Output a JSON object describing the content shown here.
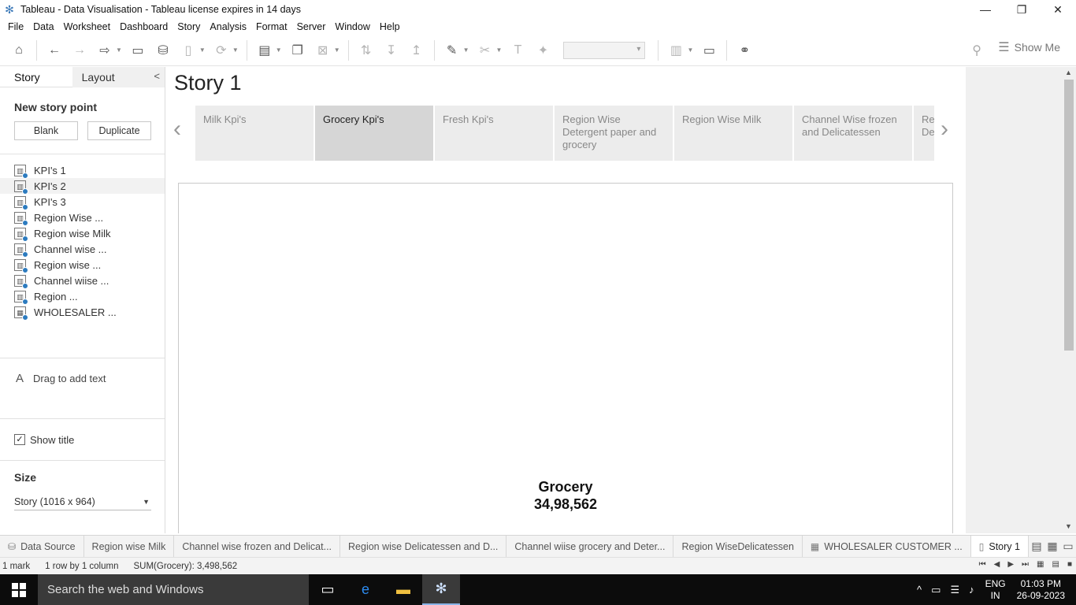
{
  "window": {
    "title": "Tableau - Data Visualisation - Tableau license expires in 14 days",
    "buttons": [
      "minimize",
      "restore",
      "close"
    ]
  },
  "menu": [
    "File",
    "Data",
    "Worksheet",
    "Dashboard",
    "Story",
    "Analysis",
    "Format",
    "Server",
    "Window",
    "Help"
  ],
  "toolbar": {
    "show_me_label": "Show Me"
  },
  "left_panel": {
    "tabs": {
      "story": "Story",
      "layout": "Layout"
    },
    "new_story_point_heading": "New story point",
    "blank_button": "Blank",
    "duplicate_button": "Duplicate",
    "sheets": [
      {
        "label": "KPI's 1",
        "icon": "worksheet-icon"
      },
      {
        "label": "KPI's 2",
        "icon": "worksheet-icon"
      },
      {
        "label": "KPI's 3",
        "icon": "worksheet-icon"
      },
      {
        "label": "Region Wise ...",
        "icon": "worksheet-icon"
      },
      {
        "label": "Region wise Milk",
        "icon": "worksheet-icon"
      },
      {
        "label": "Channel wise ...",
        "icon": "worksheet-icon"
      },
      {
        "label": "Region wise ...",
        "icon": "worksheet-icon"
      },
      {
        "label": "Channel wiise ...",
        "icon": "worksheet-icon"
      },
      {
        "label": "Region ...",
        "icon": "worksheet-icon"
      },
      {
        "label": "WHOLESALER ...",
        "icon": "dashboard-icon"
      }
    ],
    "drag_text": "Drag to add text",
    "show_title_label": "Show title",
    "show_title_checked": true,
    "size_heading": "Size",
    "size_value": "Story (1016 x 964)"
  },
  "story": {
    "title": "Story 1",
    "points": [
      {
        "label": "Milk Kpi's",
        "active": false
      },
      {
        "label": "Grocery Kpi's",
        "active": true
      },
      {
        "label": "Fresh Kpi's",
        "active": false
      },
      {
        "label": "Region Wise Detergent paper and grocery",
        "active": false
      },
      {
        "label": "Region Wise Milk",
        "active": false
      },
      {
        "label": "Channel Wise frozen and Delicatessen",
        "active": false
      },
      {
        "label": "Region Wise Detergent and Del...",
        "active": false
      }
    ],
    "kpi": {
      "label": "Grocery",
      "value": "34,98,562"
    }
  },
  "sheet_tabs": [
    {
      "label": "Data Source",
      "icon": "database-icon"
    },
    {
      "label": "Region wise Milk"
    },
    {
      "label": "Channel wise frozen and Delicat..."
    },
    {
      "label": "Region wise Delicatessen and D..."
    },
    {
      "label": "Channel wiise grocery and Deter..."
    },
    {
      "label": "Region WiseDelicatessen"
    },
    {
      "label": "WHOLESALER CUSTOMER ...",
      "icon": "dashboard-icon"
    },
    {
      "label": "Story 1",
      "icon": "story-icon",
      "active": true
    }
  ],
  "status": {
    "marks": "1 mark",
    "rows": "1 row by 1 column",
    "sum": "SUM(Grocery): 3,498,562"
  },
  "taskbar": {
    "search_placeholder": "Search the web and Windows",
    "lang_top": "ENG",
    "lang_bottom": "IN",
    "time": "01:03 PM",
    "date": "26-09-2023"
  },
  "colors": {
    "accent": "#2c7bbf",
    "active_story_point": "#d6d6d6",
    "inactive_story_point": "#ececec",
    "taskbar": "#0c0c0c"
  }
}
